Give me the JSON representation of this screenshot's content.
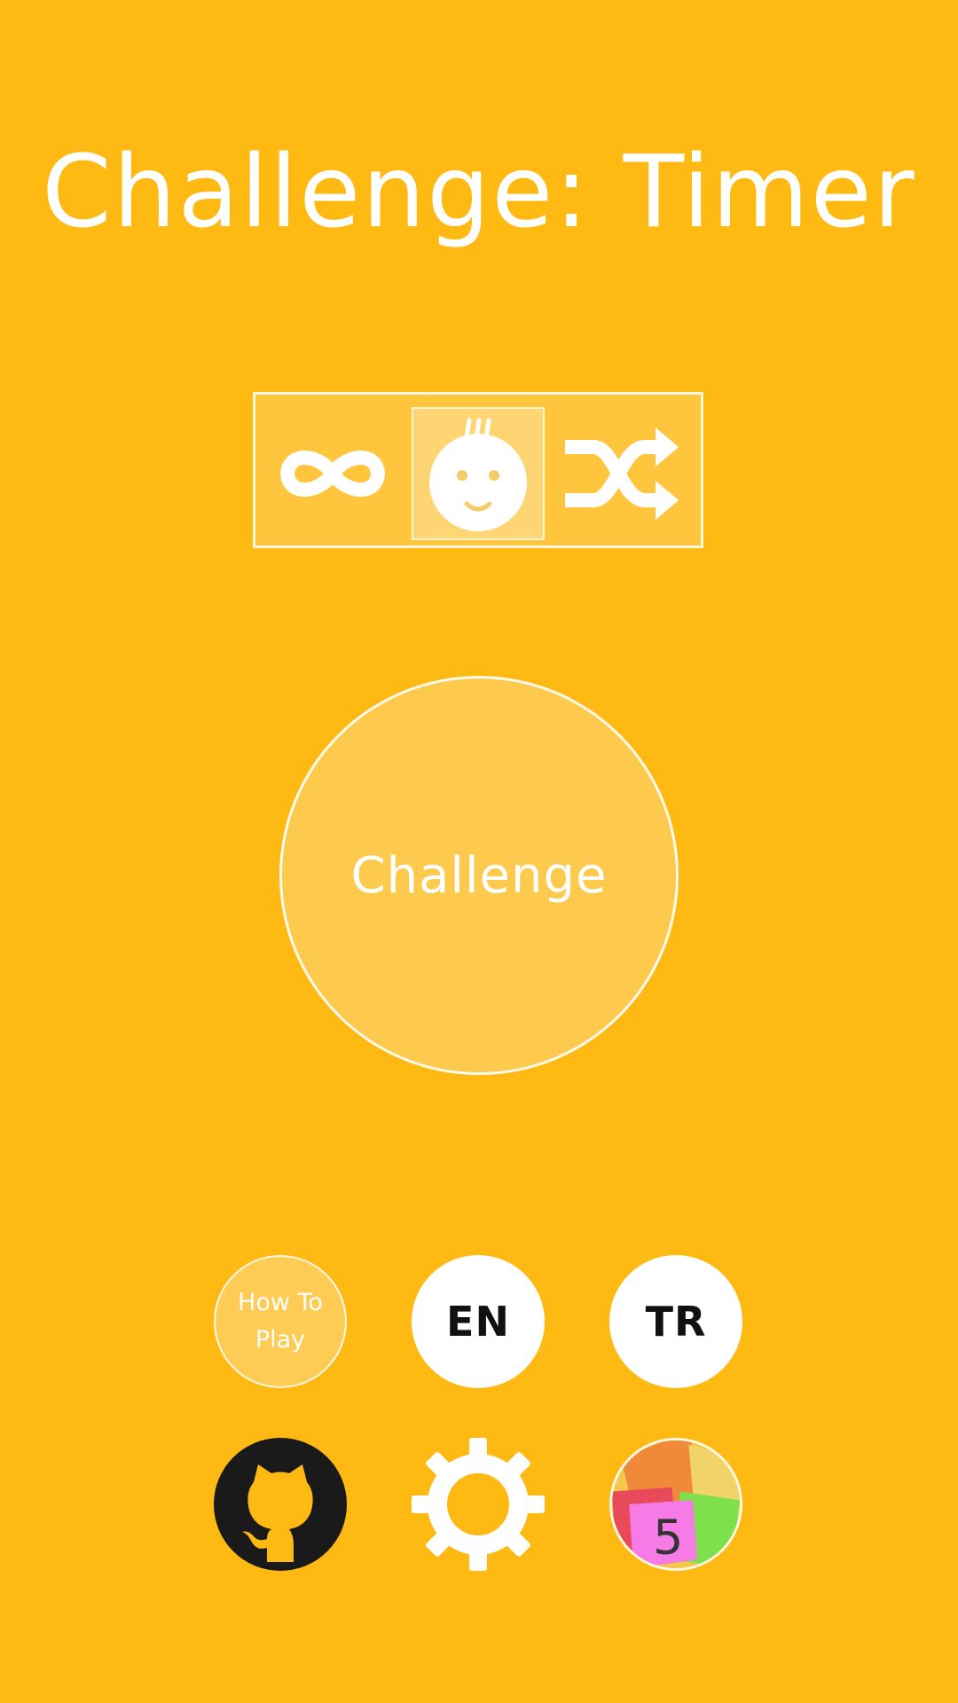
{
  "title": "Challenge: Timer",
  "modes": [
    {
      "icon": "infinity-icon",
      "selected": false
    },
    {
      "icon": "sweating-face-icon",
      "selected": true
    },
    {
      "icon": "shuffle-icon",
      "selected": false
    }
  ],
  "challenge_button": {
    "label": "Challenge"
  },
  "bottom": {
    "how_to_play": "How To Play",
    "lang_en": "EN",
    "lang_tr": "TR",
    "github_icon": "github-icon",
    "settings_icon": "gear-icon",
    "app_icon": "app-icon",
    "app_icon_number": "5"
  },
  "colors": {
    "background": "#FEB913",
    "white": "#FFFFFF",
    "dark": "#1A1A1A"
  }
}
